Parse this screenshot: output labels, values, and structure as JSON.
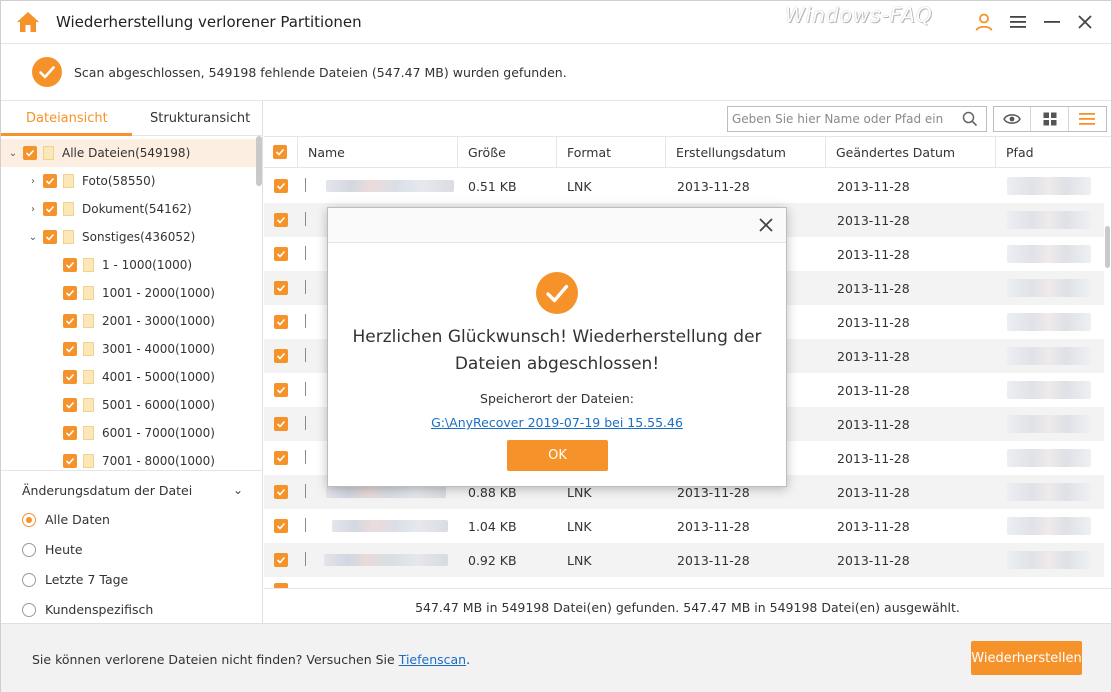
{
  "app": {
    "title": "Wiederherstellung verlorener Partitionen",
    "watermark": "Windows-FAQ"
  },
  "status": {
    "message": "Scan abgeschlossen, 549198 fehlende Dateien (547.47 MB) wurden gefunden."
  },
  "sidebar": {
    "tabs": [
      {
        "label": "Dateiansicht",
        "active": true
      },
      {
        "label": "Strukturansicht",
        "active": false
      }
    ],
    "tree": [
      {
        "label": "Alle Dateien(549198)",
        "level": 0,
        "expanded": true,
        "selected": true
      },
      {
        "label": "Foto(58550)",
        "level": 1,
        "expanded": false
      },
      {
        "label": "Dokument(54162)",
        "level": 1,
        "expanded": false
      },
      {
        "label": "Sonstiges(436052)",
        "level": 1,
        "expanded": true
      },
      {
        "label": "1 - 1000(1000)",
        "level": 2
      },
      {
        "label": "1001 - 2000(1000)",
        "level": 2
      },
      {
        "label": "2001 - 3000(1000)",
        "level": 2
      },
      {
        "label": "3001 - 4000(1000)",
        "level": 2
      },
      {
        "label": "4001 - 5000(1000)",
        "level": 2
      },
      {
        "label": "5001 - 6000(1000)",
        "level": 2
      },
      {
        "label": "6001 - 7000(1000)",
        "level": 2
      },
      {
        "label": "7001 - 8000(1000)",
        "level": 2
      }
    ],
    "filter": {
      "title": "Änderungsdatum der Datei",
      "options": [
        {
          "label": "Alle Daten",
          "selected": true
        },
        {
          "label": "Heute",
          "selected": false
        },
        {
          "label": "Letzte 7 Tage",
          "selected": false
        },
        {
          "label": "Kundenspezifisch",
          "selected": false
        }
      ]
    }
  },
  "search": {
    "placeholder": "Geben Sie hier Name oder Pfad ein"
  },
  "table": {
    "columns": [
      "Name",
      "Größe",
      "Format",
      "Erstellungsdatum",
      "Geändertes Datum",
      "Pfad"
    ],
    "rows": [
      {
        "size": "0.51 KB",
        "format": "LNK",
        "created": "2013-11-28",
        "modified": "2013-11-28"
      },
      {
        "size": "",
        "format": "",
        "created": "",
        "modified": "2013-11-28"
      },
      {
        "size": "",
        "format": "",
        "created": "",
        "modified": "2013-11-28"
      },
      {
        "size": "",
        "format": "",
        "created": "",
        "modified": "2013-11-28"
      },
      {
        "size": "",
        "format": "",
        "created": "",
        "modified": "2013-11-28"
      },
      {
        "size": "",
        "format": "",
        "created": "",
        "modified": "2013-11-28"
      },
      {
        "size": "",
        "format": "",
        "created": "",
        "modified": "2013-11-28"
      },
      {
        "size": "",
        "format": "",
        "created": "",
        "modified": "2013-11-28"
      },
      {
        "size": "",
        "format": "",
        "created": "",
        "modified": "2013-11-28"
      },
      {
        "size": "0.88 KB",
        "format": "LNK",
        "created": "2013-11-28",
        "modified": "2013-11-28"
      },
      {
        "size": "1.04 KB",
        "format": "LNK",
        "created": "2013-11-28",
        "modified": "2013-11-28"
      },
      {
        "size": "0.92 KB",
        "format": "LNK",
        "created": "2013-11-28",
        "modified": "2013-11-28"
      }
    ],
    "summary": "547.47 MB in 549198 Datei(en) gefunden. 547.47 MB in 549198 Datei(en) ausgewählt."
  },
  "footer": {
    "hint_text": "Sie können verlorene Dateien nicht finden? Versuchen Sie",
    "hint_link": "Tiefenscan",
    "hint_end": ".",
    "recover_label": "Wiederherstellen"
  },
  "modal": {
    "message": "Herzlichen Glückwunsch! Wiederherstellung der Dateien abgeschlossen!",
    "location_label": "Speicherort der Dateien:",
    "location_link": "G:\\AnyRecover 2019-07-19 bei 15.55.46",
    "ok_label": "OK"
  },
  "colors": {
    "accent": "#f5922a",
    "link": "#1a6fc4"
  }
}
